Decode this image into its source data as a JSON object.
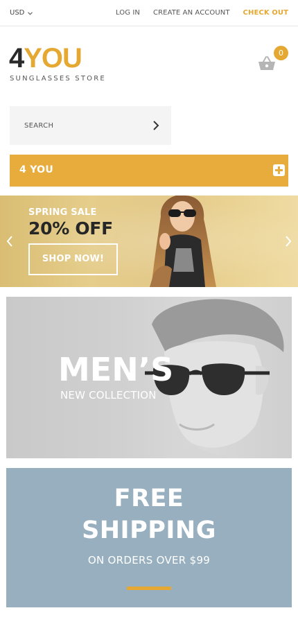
{
  "topbar": {
    "currency": "USD",
    "links": {
      "login": "LOG IN",
      "create_account": "CREATE AN ACCOUNT",
      "checkout": "CHECK OUT"
    }
  },
  "logo": {
    "number": "4",
    "word": "YOU",
    "tagline": "SUNGLASSES STORE"
  },
  "cart": {
    "icon": "basket-icon",
    "count": "0"
  },
  "search": {
    "placeholder": "SEARCH",
    "icon": "chevron-right-icon"
  },
  "menu": {
    "label": "4 YOU",
    "icon": "plus-icon"
  },
  "slider": {
    "kicker": "SPRING SALE",
    "title": "20% OFF",
    "button": "SHOP NOW!",
    "prev_icon": "chevron-left-icon",
    "next_icon": "chevron-right-icon"
  },
  "banner_men": {
    "title": "MEN’S",
    "subtitle": "NEW COLLECTION"
  },
  "banner_shipping": {
    "line1": "FREE",
    "line2": "SHIPPING",
    "subtitle": "ON ORDERS OVER $99"
  },
  "colors": {
    "accent": "#e5a832",
    "menu_bar": "#e8ac3c",
    "shipping_bg": "#97afbf",
    "search_bg": "#f4f4f4"
  }
}
